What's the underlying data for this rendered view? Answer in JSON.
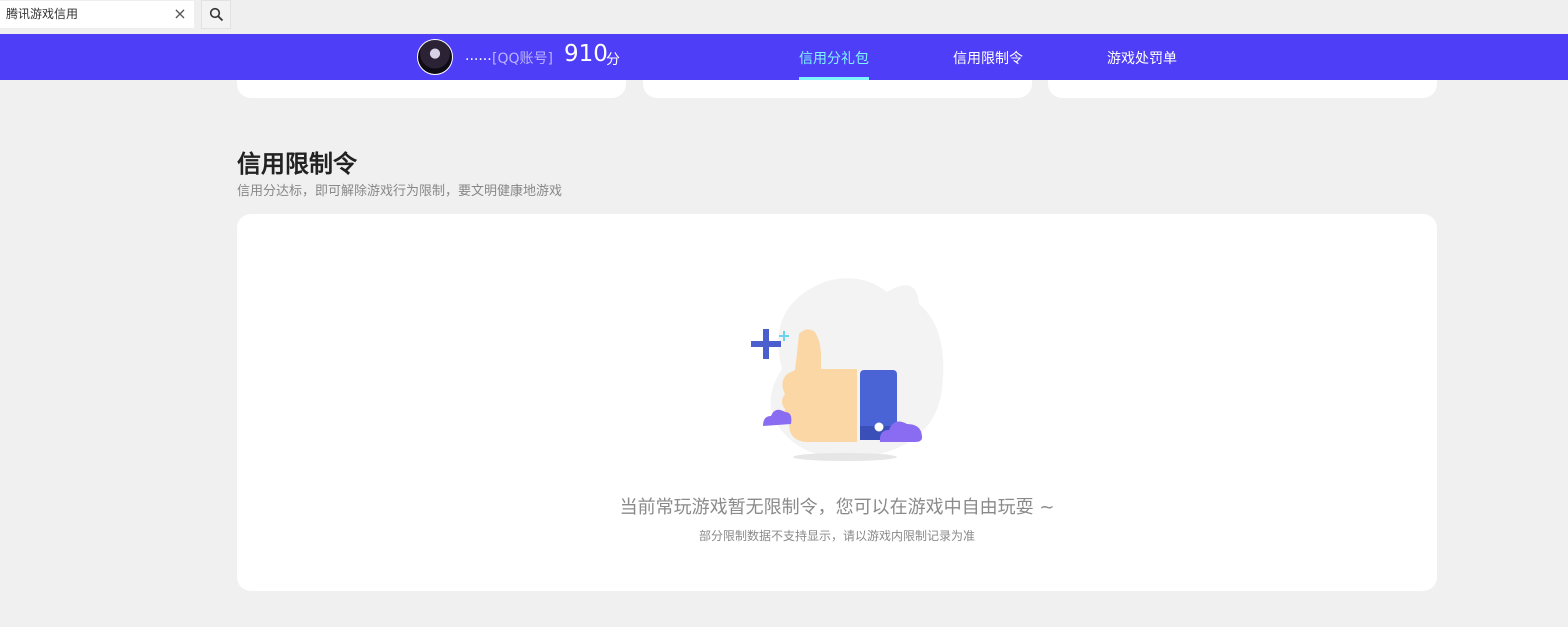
{
  "search": {
    "value": "腾讯游戏信用",
    "clear_icon": "close-icon",
    "button_icon": "search-icon"
  },
  "nav": {
    "user_name": "......",
    "account_type": "[QQ账号]",
    "score": "910",
    "score_unit": "分",
    "tabs": [
      {
        "label": "信用分礼包",
        "active": true
      },
      {
        "label": "信用限制令",
        "active": false
      },
      {
        "label": "游戏处罚单",
        "active": false
      }
    ],
    "colors": {
      "bar": "#4f3ef8",
      "active": "#7ff4ff"
    }
  },
  "section": {
    "title": "信用限制令",
    "subtitle": "信用分达标，即可解除游戏行为限制，要文明健康地游戏",
    "empty_title": "当前常玩游戏暂无限制令，您可以在游戏中自由玩耍 ~",
    "empty_note": "部分限制数据不支持显示，请以游戏内限制记录为准",
    "illustration_icon": "thumbs-up-icon"
  }
}
